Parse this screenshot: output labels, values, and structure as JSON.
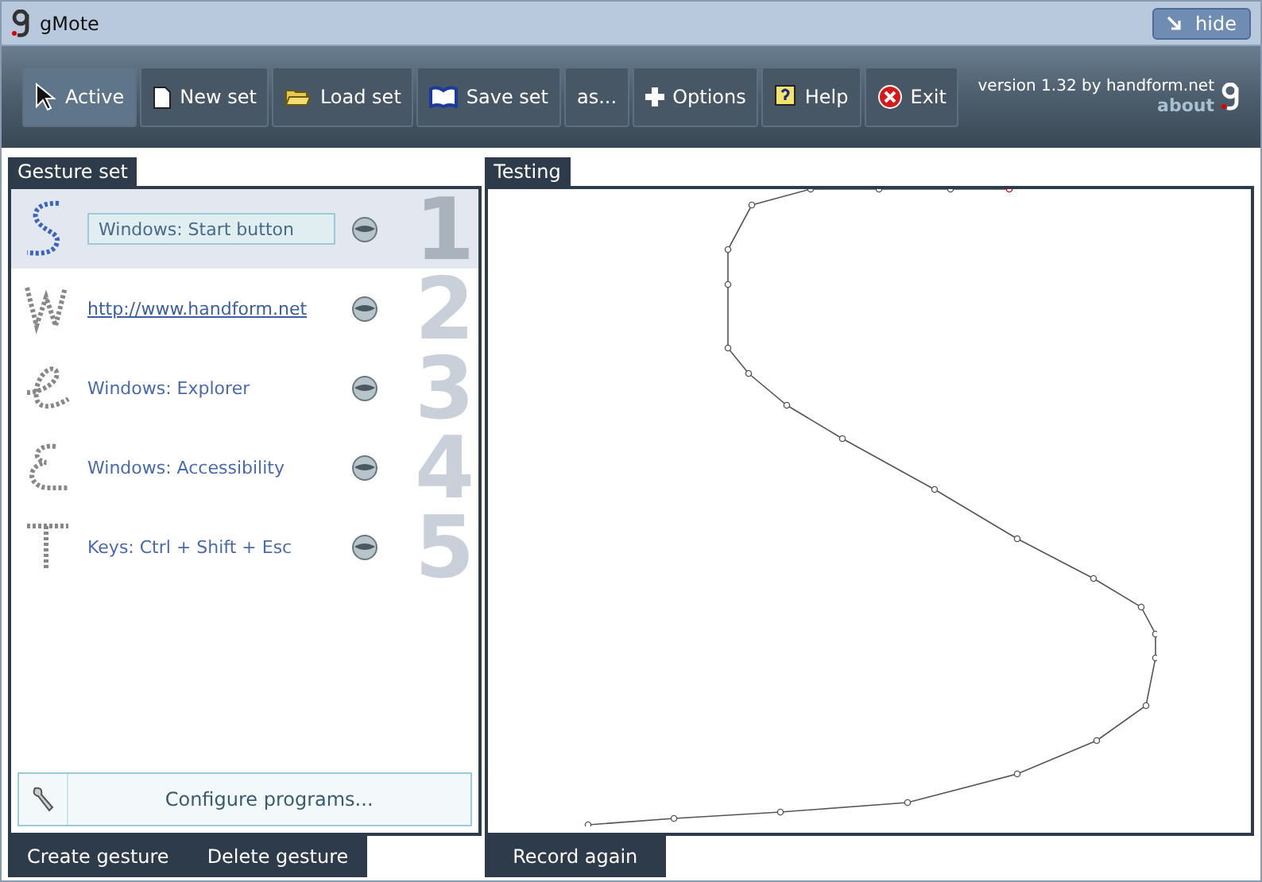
{
  "window": {
    "title": "gMote",
    "hide_button": "hide"
  },
  "toolbar": {
    "buttons": [
      {
        "label": "Active",
        "selected": true
      },
      {
        "label": "New set",
        "selected": false
      },
      {
        "label": "Load set",
        "selected": false
      },
      {
        "label": "Save set",
        "selected": false
      },
      {
        "label": "as...",
        "selected": false
      },
      {
        "label": "Options",
        "selected": false
      },
      {
        "label": "Help",
        "selected": false
      },
      {
        "label": "Exit",
        "selected": false
      }
    ],
    "version": "version 1.32 by handform.net",
    "about": "about"
  },
  "gesture_set": {
    "title": "Gesture set",
    "items": [
      {
        "action": "Windows: Start button",
        "number": "1",
        "kind": "field",
        "selected": true
      },
      {
        "action": "http://www.handform.net",
        "number": "2",
        "kind": "link",
        "selected": false
      },
      {
        "action": "Windows: Explorer",
        "number": "3",
        "kind": "text",
        "selected": false
      },
      {
        "action": "Windows: Accessibility",
        "number": "4",
        "kind": "text",
        "selected": false
      },
      {
        "action": "Keys: Ctrl + Shift + Esc",
        "number": "5",
        "kind": "text",
        "selected": false
      }
    ],
    "configure": "Configure programs...",
    "buttons": [
      "Create gesture",
      "Delete gesture"
    ]
  },
  "testing": {
    "title": "Testing",
    "button": "Record again"
  }
}
